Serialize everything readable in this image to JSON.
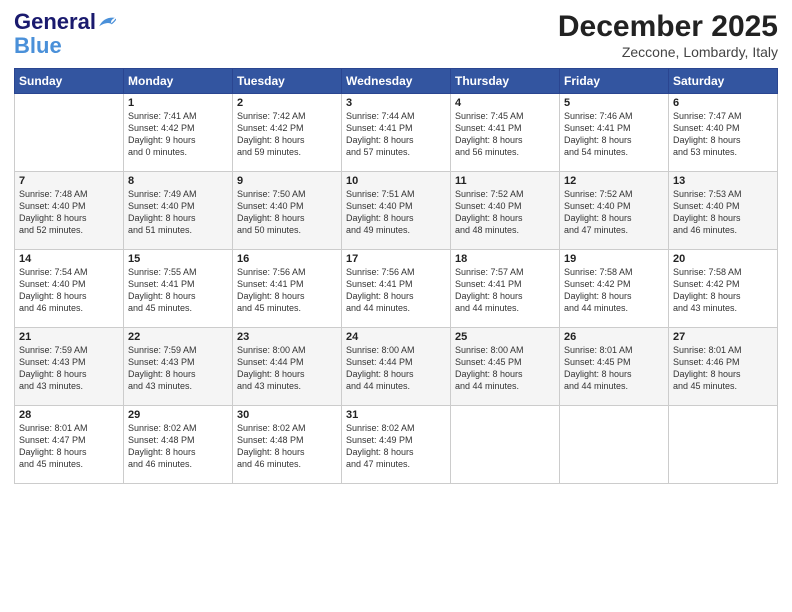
{
  "header": {
    "logo_general": "General",
    "logo_blue": "Blue",
    "month": "December 2025",
    "location": "Zeccone, Lombardy, Italy"
  },
  "days_of_week": [
    "Sunday",
    "Monday",
    "Tuesday",
    "Wednesday",
    "Thursday",
    "Friday",
    "Saturday"
  ],
  "weeks": [
    [
      {
        "day": "",
        "content": ""
      },
      {
        "day": "1",
        "content": "Sunrise: 7:41 AM\nSunset: 4:42 PM\nDaylight: 9 hours\nand 0 minutes."
      },
      {
        "day": "2",
        "content": "Sunrise: 7:42 AM\nSunset: 4:42 PM\nDaylight: 8 hours\nand 59 minutes."
      },
      {
        "day": "3",
        "content": "Sunrise: 7:44 AM\nSunset: 4:41 PM\nDaylight: 8 hours\nand 57 minutes."
      },
      {
        "day": "4",
        "content": "Sunrise: 7:45 AM\nSunset: 4:41 PM\nDaylight: 8 hours\nand 56 minutes."
      },
      {
        "day": "5",
        "content": "Sunrise: 7:46 AM\nSunset: 4:41 PM\nDaylight: 8 hours\nand 54 minutes."
      },
      {
        "day": "6",
        "content": "Sunrise: 7:47 AM\nSunset: 4:40 PM\nDaylight: 8 hours\nand 53 minutes."
      }
    ],
    [
      {
        "day": "7",
        "content": "Sunrise: 7:48 AM\nSunset: 4:40 PM\nDaylight: 8 hours\nand 52 minutes."
      },
      {
        "day": "8",
        "content": "Sunrise: 7:49 AM\nSunset: 4:40 PM\nDaylight: 8 hours\nand 51 minutes."
      },
      {
        "day": "9",
        "content": "Sunrise: 7:50 AM\nSunset: 4:40 PM\nDaylight: 8 hours\nand 50 minutes."
      },
      {
        "day": "10",
        "content": "Sunrise: 7:51 AM\nSunset: 4:40 PM\nDaylight: 8 hours\nand 49 minutes."
      },
      {
        "day": "11",
        "content": "Sunrise: 7:52 AM\nSunset: 4:40 PM\nDaylight: 8 hours\nand 48 minutes."
      },
      {
        "day": "12",
        "content": "Sunrise: 7:52 AM\nSunset: 4:40 PM\nDaylight: 8 hours\nand 47 minutes."
      },
      {
        "day": "13",
        "content": "Sunrise: 7:53 AM\nSunset: 4:40 PM\nDaylight: 8 hours\nand 46 minutes."
      }
    ],
    [
      {
        "day": "14",
        "content": "Sunrise: 7:54 AM\nSunset: 4:40 PM\nDaylight: 8 hours\nand 46 minutes."
      },
      {
        "day": "15",
        "content": "Sunrise: 7:55 AM\nSunset: 4:41 PM\nDaylight: 8 hours\nand 45 minutes."
      },
      {
        "day": "16",
        "content": "Sunrise: 7:56 AM\nSunset: 4:41 PM\nDaylight: 8 hours\nand 45 minutes."
      },
      {
        "day": "17",
        "content": "Sunrise: 7:56 AM\nSunset: 4:41 PM\nDaylight: 8 hours\nand 44 minutes."
      },
      {
        "day": "18",
        "content": "Sunrise: 7:57 AM\nSunset: 4:41 PM\nDaylight: 8 hours\nand 44 minutes."
      },
      {
        "day": "19",
        "content": "Sunrise: 7:58 AM\nSunset: 4:42 PM\nDaylight: 8 hours\nand 44 minutes."
      },
      {
        "day": "20",
        "content": "Sunrise: 7:58 AM\nSunset: 4:42 PM\nDaylight: 8 hours\nand 43 minutes."
      }
    ],
    [
      {
        "day": "21",
        "content": "Sunrise: 7:59 AM\nSunset: 4:43 PM\nDaylight: 8 hours\nand 43 minutes."
      },
      {
        "day": "22",
        "content": "Sunrise: 7:59 AM\nSunset: 4:43 PM\nDaylight: 8 hours\nand 43 minutes."
      },
      {
        "day": "23",
        "content": "Sunrise: 8:00 AM\nSunset: 4:44 PM\nDaylight: 8 hours\nand 43 minutes."
      },
      {
        "day": "24",
        "content": "Sunrise: 8:00 AM\nSunset: 4:44 PM\nDaylight: 8 hours\nand 44 minutes."
      },
      {
        "day": "25",
        "content": "Sunrise: 8:00 AM\nSunset: 4:45 PM\nDaylight: 8 hours\nand 44 minutes."
      },
      {
        "day": "26",
        "content": "Sunrise: 8:01 AM\nSunset: 4:45 PM\nDaylight: 8 hours\nand 44 minutes."
      },
      {
        "day": "27",
        "content": "Sunrise: 8:01 AM\nSunset: 4:46 PM\nDaylight: 8 hours\nand 45 minutes."
      }
    ],
    [
      {
        "day": "28",
        "content": "Sunrise: 8:01 AM\nSunset: 4:47 PM\nDaylight: 8 hours\nand 45 minutes."
      },
      {
        "day": "29",
        "content": "Sunrise: 8:02 AM\nSunset: 4:48 PM\nDaylight: 8 hours\nand 46 minutes."
      },
      {
        "day": "30",
        "content": "Sunrise: 8:02 AM\nSunset: 4:48 PM\nDaylight: 8 hours\nand 46 minutes."
      },
      {
        "day": "31",
        "content": "Sunrise: 8:02 AM\nSunset: 4:49 PM\nDaylight: 8 hours\nand 47 minutes."
      },
      {
        "day": "",
        "content": ""
      },
      {
        "day": "",
        "content": ""
      },
      {
        "day": "",
        "content": ""
      }
    ]
  ]
}
